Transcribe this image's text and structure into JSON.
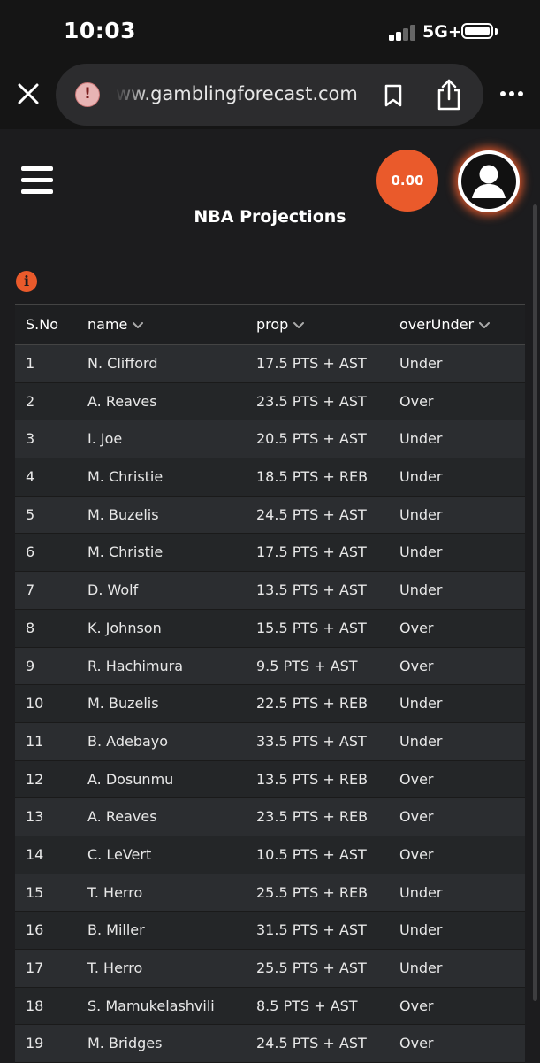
{
  "status_bar": {
    "time": "10:03",
    "network": "5G+"
  },
  "browser": {
    "url": "ww.gamblingforecast.com"
  },
  "header": {
    "balance": "0.00",
    "title": "NBA Projections"
  },
  "icons": [
    "close-icon",
    "alert-icon",
    "bookmark-icon",
    "share-icon",
    "more-icon",
    "hamburger-icon",
    "avatar-icon",
    "info-icon",
    "chevron-down-icon"
  ],
  "colors": {
    "accent": "#ea5a2b",
    "background": "#1c1c1e",
    "row_odd": "#2b2d30",
    "row_even": "#242628"
  },
  "table": {
    "headers": {
      "sno": "S.No",
      "name": "name",
      "prop": "prop",
      "over_under": "overUnder"
    },
    "rows": [
      {
        "sno": "1",
        "name": "N. Clifford",
        "prop": "17.5 PTS + AST",
        "ou": "Under"
      },
      {
        "sno": "2",
        "name": "A. Reaves",
        "prop": "23.5 PTS + AST",
        "ou": "Over"
      },
      {
        "sno": "3",
        "name": "I. Joe",
        "prop": "20.5 PTS + AST",
        "ou": "Under"
      },
      {
        "sno": "4",
        "name": "M. Christie",
        "prop": "18.5 PTS + REB",
        "ou": "Under"
      },
      {
        "sno": "5",
        "name": "M. Buzelis",
        "prop": "24.5 PTS + AST",
        "ou": "Under"
      },
      {
        "sno": "6",
        "name": "M. Christie",
        "prop": "17.5 PTS + AST",
        "ou": "Under"
      },
      {
        "sno": "7",
        "name": "D. Wolf",
        "prop": "13.5 PTS + AST",
        "ou": "Under"
      },
      {
        "sno": "8",
        "name": "K. Johnson",
        "prop": "15.5 PTS + AST",
        "ou": "Over"
      },
      {
        "sno": "9",
        "name": "R. Hachimura",
        "prop": "9.5 PTS + AST",
        "ou": "Over"
      },
      {
        "sno": "10",
        "name": "M. Buzelis",
        "prop": "22.5 PTS + REB",
        "ou": "Under"
      },
      {
        "sno": "11",
        "name": "B. Adebayo",
        "prop": "33.5 PTS + AST",
        "ou": "Under"
      },
      {
        "sno": "12",
        "name": "A. Dosunmu",
        "prop": "13.5 PTS + REB",
        "ou": "Over"
      },
      {
        "sno": "13",
        "name": "A. Reaves",
        "prop": "23.5 PTS + REB",
        "ou": "Over"
      },
      {
        "sno": "14",
        "name": "C. LeVert",
        "prop": "10.5 PTS + AST",
        "ou": "Over"
      },
      {
        "sno": "15",
        "name": "T. Herro",
        "prop": "25.5 PTS + REB",
        "ou": "Under"
      },
      {
        "sno": "16",
        "name": "B. Miller",
        "prop": "31.5 PTS + AST",
        "ou": "Under"
      },
      {
        "sno": "17",
        "name": "T. Herro",
        "prop": "25.5 PTS + AST",
        "ou": "Under"
      },
      {
        "sno": "18",
        "name": "S. Mamukelashvili",
        "prop": "8.5 PTS + AST",
        "ou": "Over"
      },
      {
        "sno": "19",
        "name": "M. Bridges",
        "prop": "24.5 PTS + AST",
        "ou": "Over"
      }
    ]
  }
}
